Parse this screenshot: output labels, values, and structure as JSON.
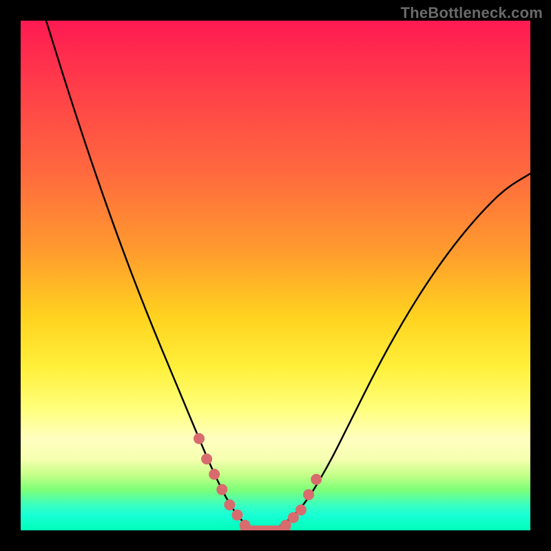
{
  "watermark": "TheBottleneck.com",
  "chart_data": {
    "type": "line",
    "title": "",
    "xlabel": "",
    "ylabel": "",
    "xlim": [
      0,
      100
    ],
    "ylim": [
      0,
      100
    ],
    "gradient_stops": [
      {
        "pct": 0,
        "color": "#ff1a52"
      },
      {
        "pct": 12,
        "color": "#ff3b4a"
      },
      {
        "pct": 30,
        "color": "#ff6a3e"
      },
      {
        "pct": 45,
        "color": "#ff9a2e"
      },
      {
        "pct": 58,
        "color": "#ffd21f"
      },
      {
        "pct": 68,
        "color": "#fff03a"
      },
      {
        "pct": 76,
        "color": "#ffff7a"
      },
      {
        "pct": 82,
        "color": "#ffffc0"
      },
      {
        "pct": 86,
        "color": "#f6ffb0"
      },
      {
        "pct": 89,
        "color": "#c7ff8a"
      },
      {
        "pct": 92,
        "color": "#7fff78"
      },
      {
        "pct": 95,
        "color": "#3affc0"
      },
      {
        "pct": 97,
        "color": "#18ffd6"
      },
      {
        "pct": 100,
        "color": "#00ffb8"
      }
    ],
    "series": [
      {
        "name": "bottleneck-curve",
        "x": [
          5,
          10,
          15,
          20,
          25,
          30,
          35,
          38,
          41,
          44,
          47,
          50,
          55,
          60,
          65,
          70,
          75,
          80,
          85,
          90,
          95,
          100
        ],
        "y": [
          100,
          84,
          69,
          55,
          42,
          30,
          18,
          11,
          5,
          1,
          0,
          0,
          4,
          12,
          22,
          32,
          41,
          49,
          56,
          62,
          67,
          70
        ]
      }
    ],
    "highlight_segments": [
      {
        "name": "left-near-valley",
        "color": "#d86b6d",
        "x": [
          35,
          36.5,
          38,
          39.5,
          41,
          42.5,
          44
        ],
        "y": [
          18,
          14,
          11,
          8,
          5,
          3,
          1
        ]
      },
      {
        "name": "right-near-valley",
        "color": "#d86b6d",
        "x": [
          52,
          53.5,
          55,
          56.5,
          58
        ],
        "y": [
          1,
          2.5,
          4,
          7,
          10
        ]
      }
    ],
    "valley_flat": {
      "x_start": 44,
      "x_end": 52,
      "y": 0,
      "color": "#d86b6d"
    }
  }
}
